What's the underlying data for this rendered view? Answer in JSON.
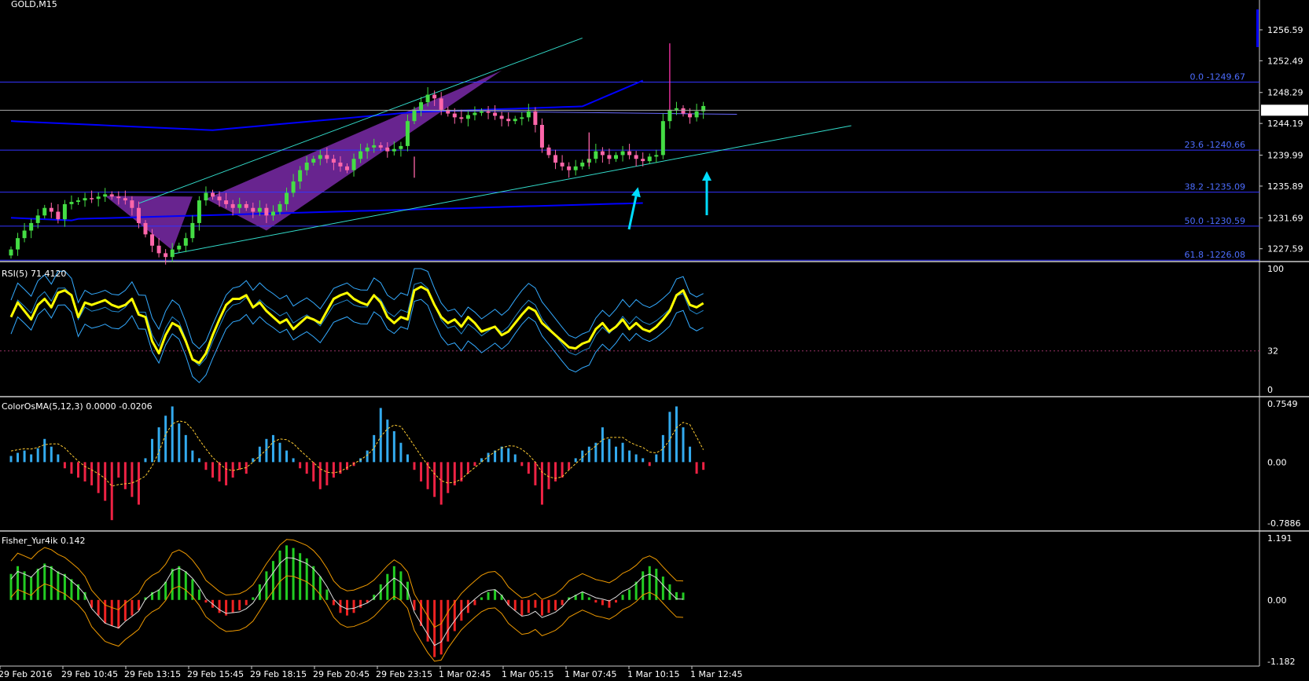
{
  "header": {
    "symbol_label": "GOLD,M15"
  },
  "colors": {
    "background": "#000000",
    "bull_candle": "#44dd44",
    "bear_candle": "#ff66aa",
    "fib_line": "#3333ff",
    "trend_channel": "#33ddcc",
    "ma_line": "#0000ff",
    "rsi_main": "#ffff00",
    "rsi_bands": "#33aaff",
    "osma_pos": "#33aaee",
    "osma_neg": "#ee2244",
    "fisher_pos": "#22cc22",
    "fisher_neg": "#ee2222",
    "fisher_bands": "#ee9900",
    "arrow": "#00ddff",
    "wedge_fill": "#7a2aa8"
  },
  "chart_data": [
    {
      "type": "candlestick",
      "title": "GOLD,M15",
      "y_ticks": [
        "1256.59",
        "1252.49",
        "1248.29",
        "1244.19",
        "1239.99",
        "1235.89",
        "1231.69",
        "1227.59"
      ],
      "ylim": [
        1226.0,
        1259.5
      ],
      "current_price": "1245.94",
      "fib_levels": [
        {
          "label": "0.0 -1249.67",
          "value": 1249.67
        },
        {
          "label": "23.6 -1240.66",
          "value": 1240.66
        },
        {
          "label": "38.2 -1235.09",
          "value": 1235.09
        },
        {
          "label": "50.0 -1230.59",
          "value": 1230.59
        },
        {
          "label": "61.8 -1226.08",
          "value": 1226.08
        }
      ],
      "x_labels": [
        "29 Feb 2016",
        "29 Feb 10:45",
        "29 Feb 13:15",
        "29 Feb 15:45",
        "29 Feb 18:15",
        "29 Feb 20:45",
        "29 Feb 23:15",
        "1 Mar 02:45",
        "1 Mar 05:15",
        "1 Mar 07:45",
        "1 Mar 10:15",
        "1 Mar 12:45"
      ],
      "close": [
        1227.5,
        1229.0,
        1230.0,
        1231.0,
        1232.0,
        1233.0,
        1232.5,
        1231.5,
        1233.5,
        1233.8,
        1234.0,
        1234.3,
        1234.2,
        1234.5,
        1234.8,
        1234.5,
        1234.3,
        1234.0,
        1233.0,
        1231.0,
        1229.5,
        1228.0,
        1227.0,
        1226.5,
        1227.5,
        1228.0,
        1229.0,
        1231.0,
        1234.0,
        1235.0,
        1234.5,
        1234.0,
        1233.5,
        1233.0,
        1233.5,
        1233.0,
        1232.5,
        1233.0,
        1232.0,
        1232.5,
        1233.5,
        1235.0,
        1236.5,
        1238.0,
        1239.0,
        1239.5,
        1240.0,
        1239.5,
        1239.0,
        1238.5,
        1238.0,
        1239.5,
        1240.5,
        1241.0,
        1241.3,
        1241.0,
        1240.5,
        1240.8,
        1241.2,
        1244.5,
        1246.0,
        1247.0,
        1248.0,
        1247.5,
        1246.0,
        1245.5,
        1245.0,
        1244.8,
        1245.3,
        1245.6,
        1245.8,
        1245.6,
        1245.2,
        1244.8,
        1244.5,
        1244.8,
        1245.0,
        1245.8,
        1244.0,
        1241.0,
        1240.0,
        1239.0,
        1238.5,
        1238.0,
        1238.5,
        1239.0,
        1239.5,
        1240.5,
        1240.0,
        1239.5,
        1240.0,
        1240.5,
        1240.0,
        1239.5,
        1239.2,
        1239.8,
        1240.0,
        1244.5,
        1246.0,
        1246.2,
        1245.5,
        1245.0,
        1245.8,
        1246.5
      ]
    },
    {
      "type": "line",
      "title": "RSI(5) 71.4120",
      "y_ticks": [
        "100",
        "32",
        "0"
      ],
      "ylim": [
        0,
        100
      ],
      "level": 32,
      "values": [
        60,
        72,
        65,
        58,
        70,
        75,
        68,
        80,
        82,
        78,
        60,
        72,
        70,
        72,
        74,
        70,
        68,
        70,
        75,
        62,
        60,
        40,
        30,
        45,
        55,
        52,
        40,
        25,
        22,
        30,
        45,
        58,
        70,
        75,
        75,
        78,
        68,
        72,
        65,
        60,
        55,
        58,
        50,
        55,
        60,
        58,
        55,
        65,
        75,
        78,
        80,
        75,
        72,
        70,
        78,
        72,
        60,
        55,
        60,
        58,
        82,
        85,
        82,
        70,
        60,
        55,
        58,
        52,
        60,
        55,
        48,
        50,
        52,
        45,
        48,
        55,
        62,
        68,
        65,
        55,
        50,
        45,
        40,
        35,
        34,
        38,
        40,
        50,
        55,
        48,
        52,
        58,
        50,
        55,
        50,
        48,
        52,
        58,
        65,
        78,
        82,
        70,
        68,
        71.41
      ]
    },
    {
      "type": "bar",
      "title": "ColorOsMA(5,12,3) 0.0000 -0.0206",
      "y_ticks": [
        "0.7549",
        "0.00",
        "-0.7886"
      ],
      "ylim": [
        -0.7886,
        0.7549
      ],
      "values": [
        0.08,
        0.12,
        0.15,
        0.1,
        0.18,
        0.3,
        0.2,
        0.1,
        -0.08,
        -0.15,
        -0.2,
        -0.25,
        -0.3,
        -0.4,
        -0.5,
        -0.75,
        -0.2,
        -0.35,
        -0.45,
        -0.55,
        0.05,
        0.3,
        0.45,
        0.6,
        0.72,
        0.5,
        0.35,
        0.15,
        0.05,
        -0.1,
        -0.2,
        -0.25,
        -0.3,
        -0.2,
        -0.1,
        -0.15,
        0.05,
        0.2,
        0.3,
        0.35,
        0.25,
        0.15,
        0.05,
        -0.08,
        -0.15,
        -0.25,
        -0.35,
        -0.3,
        -0.2,
        -0.15,
        -0.1,
        -0.05,
        0.05,
        0.15,
        0.35,
        0.7,
        0.55,
        0.4,
        0.25,
        0.1,
        -0.1,
        -0.25,
        -0.35,
        -0.45,
        -0.55,
        -0.4,
        -0.3,
        -0.25,
        -0.15,
        -0.05,
        0.05,
        0.12,
        0.15,
        0.2,
        0.18,
        0.1,
        -0.05,
        -0.15,
        -0.3,
        -0.55,
        -0.35,
        -0.25,
        -0.2,
        -0.1,
        0.05,
        0.15,
        0.2,
        0.25,
        0.45,
        0.3,
        0.2,
        0.25,
        0.15,
        0.1,
        0.05,
        -0.05,
        0.1,
        0.35,
        0.65,
        0.72,
        0.45,
        0.2,
        -0.15,
        -0.1
      ]
    },
    {
      "type": "bar",
      "title": "Fisher_Yur4ik 0.142",
      "y_ticks": [
        "1.191",
        "0.00",
        "-1.182"
      ],
      "ylim": [
        -1.182,
        1.191
      ],
      "values": [
        0.5,
        0.65,
        0.55,
        0.45,
        0.6,
        0.7,
        0.65,
        0.55,
        0.5,
        0.4,
        0.3,
        0.15,
        -0.15,
        -0.3,
        -0.45,
        -0.5,
        -0.55,
        -0.4,
        -0.3,
        -0.2,
        0.05,
        0.15,
        0.2,
        0.35,
        0.6,
        0.65,
        0.55,
        0.4,
        0.2,
        -0.05,
        -0.15,
        -0.25,
        -0.3,
        -0.25,
        -0.2,
        -0.1,
        0.05,
        0.3,
        0.55,
        0.75,
        0.95,
        1.05,
        1.0,
        0.9,
        0.8,
        0.65,
        0.45,
        0.2,
        -0.1,
        -0.25,
        -0.3,
        -0.25,
        -0.15,
        -0.05,
        0.1,
        0.3,
        0.5,
        0.65,
        0.55,
        0.35,
        -0.2,
        -0.5,
        -0.8,
        -1.1,
        -1.05,
        -0.8,
        -0.6,
        -0.4,
        -0.25,
        -0.1,
        0.05,
        0.15,
        0.2,
        0.1,
        -0.1,
        -0.2,
        -0.3,
        -0.25,
        -0.15,
        -0.3,
        -0.25,
        -0.2,
        -0.1,
        0.05,
        0.1,
        0.15,
        0.05,
        -0.05,
        -0.1,
        -0.15,
        -0.05,
        0.1,
        0.2,
        0.35,
        0.55,
        0.65,
        0.6,
        0.45,
        0.3,
        0.15,
        0.142
      ]
    }
  ]
}
